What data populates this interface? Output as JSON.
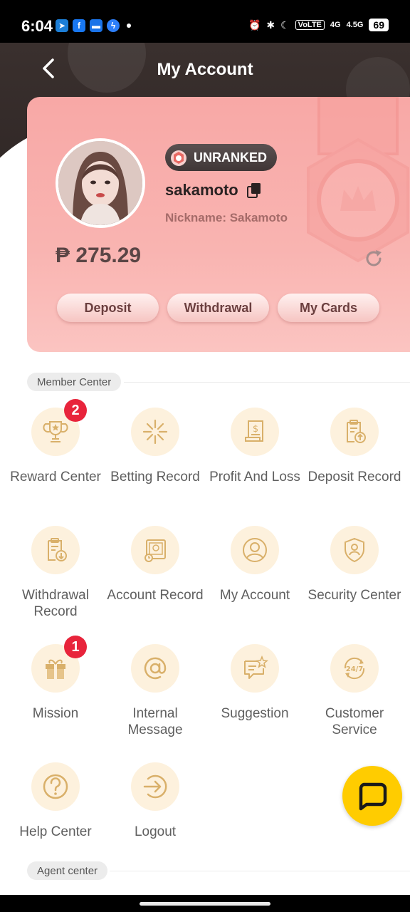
{
  "status_bar": {
    "time": "6:04",
    "volte": "VoLTE",
    "network_1": "4G",
    "network_2": "4.5G",
    "battery": "69"
  },
  "header": {
    "title": "My Account"
  },
  "profile": {
    "rank": "UNRANKED",
    "username": "sakamoto",
    "nickname": "Nickname: Sakamoto",
    "balance": "₱ 275.29"
  },
  "card_actions": [
    "Deposit",
    "Withdrawal",
    "My Cards"
  ],
  "member_center": {
    "title": "Member Center",
    "items": [
      {
        "label": "Reward Center",
        "icon": "trophy-icon",
        "badge": "2"
      },
      {
        "label": "Betting Record",
        "icon": "sparkle-icon"
      },
      {
        "label": "Profit And Loss",
        "icon": "receipt-dollar-icon"
      },
      {
        "label": "Deposit Record",
        "icon": "clipboard-upload-icon"
      },
      {
        "label": "Withdrawal Record",
        "icon": "clipboard-download-icon"
      },
      {
        "label": "Account Record",
        "icon": "ledger-icon"
      },
      {
        "label": "My Account",
        "icon": "user-circle-icon"
      },
      {
        "label": "Security Center",
        "icon": "shield-user-icon"
      },
      {
        "label": "Mission",
        "icon": "gift-icon",
        "badge": "1"
      },
      {
        "label": "Internal Message",
        "icon": "at-sign-icon"
      },
      {
        "label": "Suggestion",
        "icon": "chat-star-icon"
      },
      {
        "label": "Customer Service",
        "icon": "support-24-7-icon"
      },
      {
        "label": "Help Center",
        "icon": "question-icon"
      },
      {
        "label": "Logout",
        "icon": "logout-icon"
      }
    ]
  },
  "agent_center": {
    "title": "Agent center"
  },
  "colors": {
    "accent": "#f8a8a6",
    "icon_bg": "#fdf1dd",
    "icon_stroke": "#d9b06a",
    "badge": "#e8243b",
    "chat_fab": "#ffcc00"
  }
}
